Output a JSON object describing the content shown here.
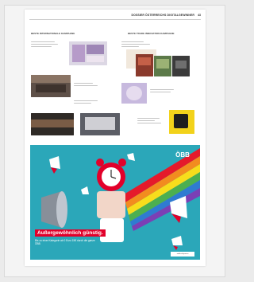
{
  "header": {
    "title": "DOSSIER ÖSTERREICHS DIGITALGEWINNER",
    "page_number": "43"
  },
  "columns": {
    "left_heading": "BESTE INTERNATIONALE KAMPAGNE",
    "right_heading": "BESTE TRADE INNOVATION KAMPAGNE"
  },
  "ad": {
    "brand": "ÖBB",
    "headline": "Außergewöhnlich günstig.",
    "subline": "Bis zu einer Kategorie ab 0 Euro 15€ durch die ganze ÖBB",
    "url": "oebb.at/sparen"
  },
  "colors": {
    "ad_background": "#2ba7b9",
    "brand_red": "#e2002a",
    "sticker_yellow": "#f2d21b"
  }
}
